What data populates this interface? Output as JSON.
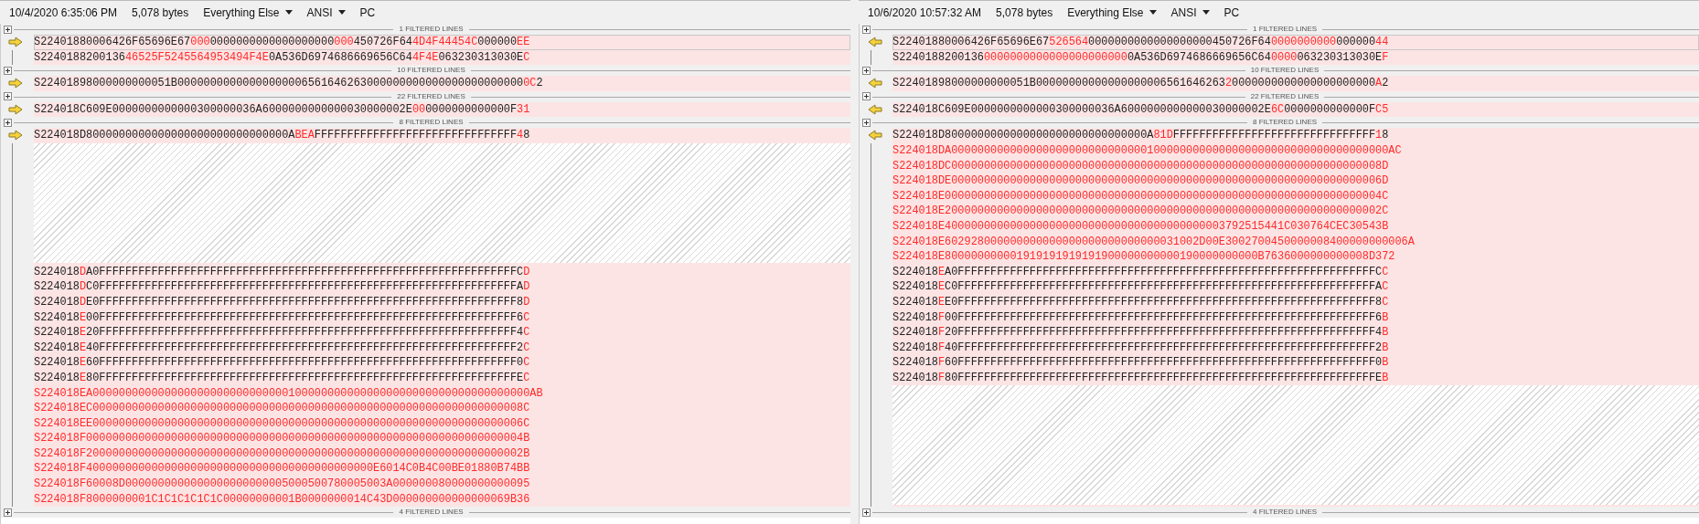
{
  "panes": [
    {
      "date": "10/4/2020 6:35:06 PM",
      "size": "5,078 bytes",
      "format": "Everything Else",
      "encoding": "ANSI",
      "line_endings": "PC"
    },
    {
      "date": "10/6/2020 10:57:32 AM",
      "size": "5,078 bytes",
      "format": "Everything Else",
      "encoding": "ANSI",
      "line_endings": "PC"
    }
  ],
  "rows": [
    {
      "kind": "separator",
      "left": "1 FILTERED LINES",
      "right": "1 FILTERED LINES"
    },
    {
      "kind": "line",
      "arrow": true,
      "current": true,
      "left": [
        {
          "text": "S22401880006426F65696E67",
          "changed": false
        },
        {
          "text": "000",
          "changed": true
        },
        {
          "text": "0000000000000000000",
          "changed": false
        },
        {
          "text": "000",
          "changed": true
        },
        {
          "text": "450726F64",
          "changed": false
        },
        {
          "text": "4D4F44454C",
          "changed": true
        },
        {
          "text": "000000",
          "changed": false
        },
        {
          "text": "EE",
          "changed": true
        }
      ],
      "right": [
        {
          "text": "S22401880006426F65696E67",
          "changed": false
        },
        {
          "text": "526564",
          "changed": true
        },
        {
          "text": "0000000000000000000450726F64",
          "changed": false
        },
        {
          "text": "0000000000",
          "changed": true
        },
        {
          "text": "000000",
          "changed": false
        },
        {
          "text": "44",
          "changed": true
        }
      ]
    },
    {
      "kind": "line",
      "arrow": false,
      "current": false,
      "left": [
        {
          "text": "S2240188200136",
          "changed": false
        },
        {
          "text": "46525F5245564953494F4E",
          "changed": true
        },
        {
          "text": "0A536D6974686669656C64",
          "changed": false
        },
        {
          "text": "4F4E",
          "changed": true
        },
        {
          "text": "063230313030E",
          "changed": false
        },
        {
          "text": "C",
          "changed": true
        }
      ],
      "right": [
        {
          "text": "S2240188200136",
          "changed": false
        },
        {
          "text": "0000000000000000000000",
          "changed": true
        },
        {
          "text": "0A536D6974686669656C64",
          "changed": false
        },
        {
          "text": "0000",
          "changed": true
        },
        {
          "text": "063230313030E",
          "changed": false
        },
        {
          "text": "F",
          "changed": true
        }
      ]
    },
    {
      "kind": "separator",
      "left": "10 FILTERED LINES",
      "right": "10 FILTERED LINES"
    },
    {
      "kind": "line",
      "arrow": true,
      "current": false,
      "left": [
        {
          "text": "S22401898000000000051B00000000000000000006561646263000000000000000000000000",
          "changed": false
        },
        {
          "text": "0C",
          "changed": true
        },
        {
          "text": "2",
          "changed": false
        }
      ],
      "right": [
        {
          "text": "S22401898000000000051B00000000000000000006561646263",
          "changed": false
        },
        {
          "text": "2",
          "changed": true
        },
        {
          "text": "0000000000000000000000",
          "changed": false
        },
        {
          "text": "A",
          "changed": true
        },
        {
          "text": "2",
          "changed": false
        }
      ]
    },
    {
      "kind": "separator",
      "left": "22 FILTERED LINES",
      "right": "22 FILTERED LINES"
    },
    {
      "kind": "line",
      "arrow": true,
      "current": false,
      "left": [
        {
          "text": "S224018C609E0000000000000300000036A6000000000000030000002E",
          "changed": false
        },
        {
          "text": "00",
          "changed": true
        },
        {
          "text": "0000000000000F",
          "changed": false
        },
        {
          "text": "31",
          "changed": true
        }
      ],
      "right": [
        {
          "text": "S224018C609E0000000000000300000036A6000000000000030000002E",
          "changed": false
        },
        {
          "text": "6C",
          "changed": true
        },
        {
          "text": "0000000000000F",
          "changed": false
        },
        {
          "text": "C5",
          "changed": true
        }
      ]
    },
    {
      "kind": "separator",
      "left": "8 FILTERED LINES",
      "right": "8 FILTERED LINES"
    },
    {
      "kind": "line",
      "arrow": true,
      "current": false,
      "left": [
        {
          "text": "S224018D8000000000000000000000000000000A",
          "changed": false
        },
        {
          "text": "BEA",
          "changed": true
        },
        {
          "text": "FFFFFFFFFFFFFFFFFFFFFFFFFFFFFFF",
          "changed": false
        },
        {
          "text": "4",
          "changed": true
        },
        {
          "text": "8",
          "changed": false
        }
      ],
      "right": [
        {
          "text": "S224018D8000000000000000000000000000000A",
          "changed": false
        },
        {
          "text": "81D",
          "changed": true
        },
        {
          "text": "FFFFFFFFFFFFFFFFFFFFFFFFFFFFFFF",
          "changed": false
        },
        {
          "text": "1",
          "changed": true
        },
        {
          "text": "8",
          "changed": false
        }
      ]
    },
    {
      "kind": "line",
      "arrow": false,
      "current": false,
      "right": [
        {
          "text": "S224018DA0000000000000000000000000000001000000000000000000000000000000000000AC",
          "changed": true
        }
      ]
    },
    {
      "kind": "line",
      "arrow": false,
      "current": false,
      "right": [
        {
          "text": "S224018DC000000000000000000000000000000000000000000000000000000000000000008D",
          "changed": true
        }
      ]
    },
    {
      "kind": "line",
      "arrow": false,
      "current": false,
      "right": [
        {
          "text": "S224018DE000000000000000000000000000000000000000000000000000000000000000006D",
          "changed": true
        }
      ]
    },
    {
      "kind": "line",
      "arrow": false,
      "current": false,
      "right": [
        {
          "text": "S224018E0000000000000000000000000000000000000000000000000000000000000000004C",
          "changed": true
        }
      ]
    },
    {
      "kind": "line",
      "arrow": false,
      "current": false,
      "right": [
        {
          "text": "S224018E2000000000000000000000000000000000000000000000000000000000000000002C",
          "changed": true
        }
      ]
    },
    {
      "kind": "line",
      "arrow": false,
      "current": false,
      "right": [
        {
          "text": "S224018E4000000000000000000000000000000000000000003792515441C030764CEC30543B",
          "changed": true
        }
      ]
    },
    {
      "kind": "line",
      "arrow": false,
      "current": false,
      "right": [
        {
          "text": "S224018E602928000000000000000000000000000031002D00E3002700450000008400000000006A",
          "changed": true
        }
      ]
    },
    {
      "kind": "line",
      "arrow": false,
      "current": false,
      "right": [
        {
          "text": "S224018E800000000001919191919191900000000000190000000000B7636000000000008D372",
          "changed": true
        }
      ]
    },
    {
      "kind": "line",
      "arrow": false,
      "current": false,
      "left": [
        {
          "text": "S224018",
          "changed": false
        },
        {
          "text": "D",
          "changed": true
        },
        {
          "text": "A0FFFFFFFFFFFFFFFFFFFFFFFFFFFFFFFFFFFFFFFFFFFFFFFFFFFFFFFFFFFFFFFFC",
          "changed": false
        },
        {
          "text": "D",
          "changed": true
        }
      ],
      "right": [
        {
          "text": "S224018",
          "changed": false
        },
        {
          "text": "E",
          "changed": true
        },
        {
          "text": "A0FFFFFFFFFFFFFFFFFFFFFFFFFFFFFFFFFFFFFFFFFFFFFFFFFFFFFFFFFFFFFFFFC",
          "changed": false
        },
        {
          "text": "C",
          "changed": true
        }
      ]
    },
    {
      "kind": "line",
      "arrow": false,
      "current": false,
      "left": [
        {
          "text": "S224018",
          "changed": false
        },
        {
          "text": "D",
          "changed": true
        },
        {
          "text": "C0FFFFFFFFFFFFFFFFFFFFFFFFFFFFFFFFFFFFFFFFFFFFFFFFFFFFFFFFFFFFFFFFA",
          "changed": false
        },
        {
          "text": "D",
          "changed": true
        }
      ],
      "right": [
        {
          "text": "S224018",
          "changed": false
        },
        {
          "text": "E",
          "changed": true
        },
        {
          "text": "C0FFFFFFFFFFFFFFFFFFFFFFFFFFFFFFFFFFFFFFFFFFFFFFFFFFFFFFFFFFFFFFFFA",
          "changed": false
        },
        {
          "text": "C",
          "changed": true
        }
      ]
    },
    {
      "kind": "line",
      "arrow": false,
      "current": false,
      "left": [
        {
          "text": "S224018",
          "changed": false
        },
        {
          "text": "D",
          "changed": true
        },
        {
          "text": "E0FFFFFFFFFFFFFFFFFFFFFFFFFFFFFFFFFFFFFFFFFFFFFFFFFFFFFFFFFFFFFFFF8",
          "changed": false
        },
        {
          "text": "D",
          "changed": true
        }
      ],
      "right": [
        {
          "text": "S224018",
          "changed": false
        },
        {
          "text": "E",
          "changed": true
        },
        {
          "text": "E0FFFFFFFFFFFFFFFFFFFFFFFFFFFFFFFFFFFFFFFFFFFFFFFFFFFFFFFFFFFFFFFF8",
          "changed": false
        },
        {
          "text": "C",
          "changed": true
        }
      ]
    },
    {
      "kind": "line",
      "arrow": false,
      "current": false,
      "left": [
        {
          "text": "S224018",
          "changed": false
        },
        {
          "text": "E",
          "changed": true
        },
        {
          "text": "00FFFFFFFFFFFFFFFFFFFFFFFFFFFFFFFFFFFFFFFFFFFFFFFFFFFFFFFFFFFFFFFF6",
          "changed": false
        },
        {
          "text": "C",
          "changed": true
        }
      ],
      "right": [
        {
          "text": "S224018",
          "changed": false
        },
        {
          "text": "F",
          "changed": true
        },
        {
          "text": "00FFFFFFFFFFFFFFFFFFFFFFFFFFFFFFFFFFFFFFFFFFFFFFFFFFFFFFFFFFFFFFFF6",
          "changed": false
        },
        {
          "text": "B",
          "changed": true
        }
      ]
    },
    {
      "kind": "line",
      "arrow": false,
      "current": false,
      "left": [
        {
          "text": "S224018",
          "changed": false
        },
        {
          "text": "E",
          "changed": true
        },
        {
          "text": "20FFFFFFFFFFFFFFFFFFFFFFFFFFFFFFFFFFFFFFFFFFFFFFFFFFFFFFFFFFFFFFFF4",
          "changed": false
        },
        {
          "text": "C",
          "changed": true
        }
      ],
      "right": [
        {
          "text": "S224018",
          "changed": false
        },
        {
          "text": "F",
          "changed": true
        },
        {
          "text": "20FFFFFFFFFFFFFFFFFFFFFFFFFFFFFFFFFFFFFFFFFFFFFFFFFFFFFFFFFFFFFFFF4",
          "changed": false
        },
        {
          "text": "B",
          "changed": true
        }
      ]
    },
    {
      "kind": "line",
      "arrow": false,
      "current": false,
      "left": [
        {
          "text": "S224018",
          "changed": false
        },
        {
          "text": "E",
          "changed": true
        },
        {
          "text": "40FFFFFFFFFFFFFFFFFFFFFFFFFFFFFFFFFFFFFFFFFFFFFFFFFFFFFFFFFFFFFFFF2",
          "changed": false
        },
        {
          "text": "C",
          "changed": true
        }
      ],
      "right": [
        {
          "text": "S224018",
          "changed": false
        },
        {
          "text": "F",
          "changed": true
        },
        {
          "text": "40FFFFFFFFFFFFFFFFFFFFFFFFFFFFFFFFFFFFFFFFFFFFFFFFFFFFFFFFFFFFFFFF2",
          "changed": false
        },
        {
          "text": "B",
          "changed": true
        }
      ]
    },
    {
      "kind": "line",
      "arrow": false,
      "current": false,
      "left": [
        {
          "text": "S224018",
          "changed": false
        },
        {
          "text": "E",
          "changed": true
        },
        {
          "text": "60FFFFFFFFFFFFFFFFFFFFFFFFFFFFFFFFFFFFFFFFFFFFFFFFFFFFFFFFFFFFFFFF0",
          "changed": false
        },
        {
          "text": "C",
          "changed": true
        }
      ],
      "right": [
        {
          "text": "S224018",
          "changed": false
        },
        {
          "text": "F",
          "changed": true
        },
        {
          "text": "60FFFFFFFFFFFFFFFFFFFFFFFFFFFFFFFFFFFFFFFFFFFFFFFFFFFFFFFFFFFFFFFF0",
          "changed": false
        },
        {
          "text": "B",
          "changed": true
        }
      ]
    },
    {
      "kind": "line",
      "arrow": false,
      "current": false,
      "left": [
        {
          "text": "S224018",
          "changed": false
        },
        {
          "text": "E",
          "changed": true
        },
        {
          "text": "80FFFFFFFFFFFFFFFFFFFFFFFFFFFFFFFFFFFFFFFFFFFFFFFFFFFFFFFFFFFFFFFFE",
          "changed": false
        },
        {
          "text": "C",
          "changed": true
        }
      ],
      "right": [
        {
          "text": "S224018",
          "changed": false
        },
        {
          "text": "F",
          "changed": true
        },
        {
          "text": "80FFFFFFFFFFFFFFFFFFFFFFFFFFFFFFFFFFFFFFFFFFFFFFFFFFFFFFFFFFFFFFFFE",
          "changed": false
        },
        {
          "text": "B",
          "changed": true
        }
      ]
    },
    {
      "kind": "line",
      "arrow": false,
      "current": false,
      "left": [
        {
          "text": "S224018EA0000000000000000000000000000001000000000000000000000000000000000000AB",
          "changed": true
        }
      ]
    },
    {
      "kind": "line",
      "arrow": false,
      "current": false,
      "left": [
        {
          "text": "S224018EC000000000000000000000000000000000000000000000000000000000000000008C",
          "changed": true
        }
      ]
    },
    {
      "kind": "line",
      "arrow": false,
      "current": false,
      "left": [
        {
          "text": "S224018EE000000000000000000000000000000000000000000000000000000000000000006C",
          "changed": true
        }
      ]
    },
    {
      "kind": "line",
      "arrow": false,
      "current": false,
      "left": [
        {
          "text": "S224018F0000000000000000000000000000000000000000000000000000000000000000004B",
          "changed": true
        }
      ]
    },
    {
      "kind": "line",
      "arrow": false,
      "current": false,
      "left": [
        {
          "text": "S224018F2000000000000000000000000000000000000000000000000000000000000000002B",
          "changed": true
        }
      ]
    },
    {
      "kind": "line",
      "arrow": false,
      "current": false,
      "left": [
        {
          "text": "S224018F40000000000000000000000000000000000000000000E6014C0B4C00BE01880B74BB",
          "changed": true
        }
      ]
    },
    {
      "kind": "line",
      "arrow": false,
      "current": false,
      "left": [
        {
          "text": "S224018F60008D0000000000000000000000005000500780005003A000000080000000000095",
          "changed": true
        }
      ]
    },
    {
      "kind": "line",
      "arrow": false,
      "current": false,
      "left": [
        {
          "text": "S224018F8000000001C1C1C1C1C1C00000000001B0000000014C43D000000000000000069B36",
          "changed": true
        }
      ]
    },
    {
      "kind": "separator",
      "left": "4 FILTERED LINES",
      "right": "4 FILTERED LINES"
    }
  ]
}
